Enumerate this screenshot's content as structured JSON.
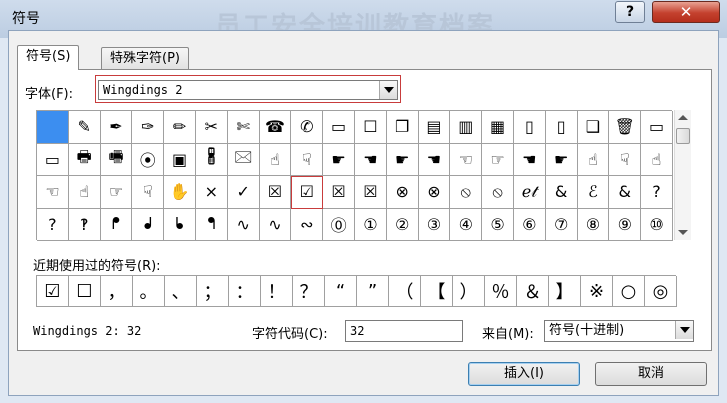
{
  "window": {
    "title": "符号",
    "background_title": "员工安全培训教育档案",
    "help_label": "?",
    "close_label": "✕"
  },
  "tabs": [
    {
      "label": "符号(S)",
      "active": true
    },
    {
      "label": "特殊字符(P)",
      "active": false
    }
  ],
  "font": {
    "label": "字体(F):",
    "value": "Wingdings 2"
  },
  "symbol_grid": [
    [
      "■",
      "✎",
      "✒",
      "✑",
      "✏",
      "✂",
      "✄",
      "☎",
      "✆",
      "▭",
      "☐",
      "❐",
      "▤",
      "▥",
      "▦",
      "▯",
      "▯",
      "❑",
      "🗑",
      "▭"
    ],
    [
      "▭",
      "🖶",
      "🖷",
      "⦿",
      "▣",
      "🖁",
      "🖂",
      "☝",
      "☟",
      "☛",
      "☚",
      "☛",
      "☚",
      "☜",
      "☞",
      "☚",
      "☛",
      "☝",
      "☟",
      "☝"
    ],
    [
      "☜",
      "☝",
      "☞",
      "☟",
      "✋",
      "×",
      "✓",
      "☒",
      "☑",
      "☒",
      "☒",
      "⊗",
      "⊗",
      "⦸",
      "⦸",
      "ℯ𝓉",
      "&",
      "ℰ",
      "&",
      "?"
    ],
    [
      "?",
      "‽",
      "ᖰ",
      "ᖱ",
      "ᖲ",
      "ᖳ",
      "∿",
      "∿",
      "∾",
      "⓪",
      "①",
      "②",
      "③",
      "④",
      "⑤",
      "⑥",
      "⑦",
      "⑧",
      "⑨",
      "⑩"
    ]
  ],
  "grid_selected_index": 0,
  "grid_highlight": {
    "row": 2,
    "col": 8
  },
  "recent": {
    "label": "近期使用过的符号(R):",
    "items": [
      "☑",
      "☐",
      "，",
      "。",
      "、",
      "；",
      "：",
      "！",
      "？",
      "“",
      "”",
      "（",
      "【",
      "）",
      "％",
      "＆",
      "】",
      "※",
      "○",
      "◎",
      "□"
    ]
  },
  "status": {
    "font_code": "Wingdings 2: 32",
    "char_code_label": "字符代码(C):",
    "char_code_value": "32",
    "from_label": "来自(M):",
    "from_value": "符号(十进制)"
  },
  "buttons": {
    "insert": "插入(I)",
    "cancel": "取消"
  }
}
